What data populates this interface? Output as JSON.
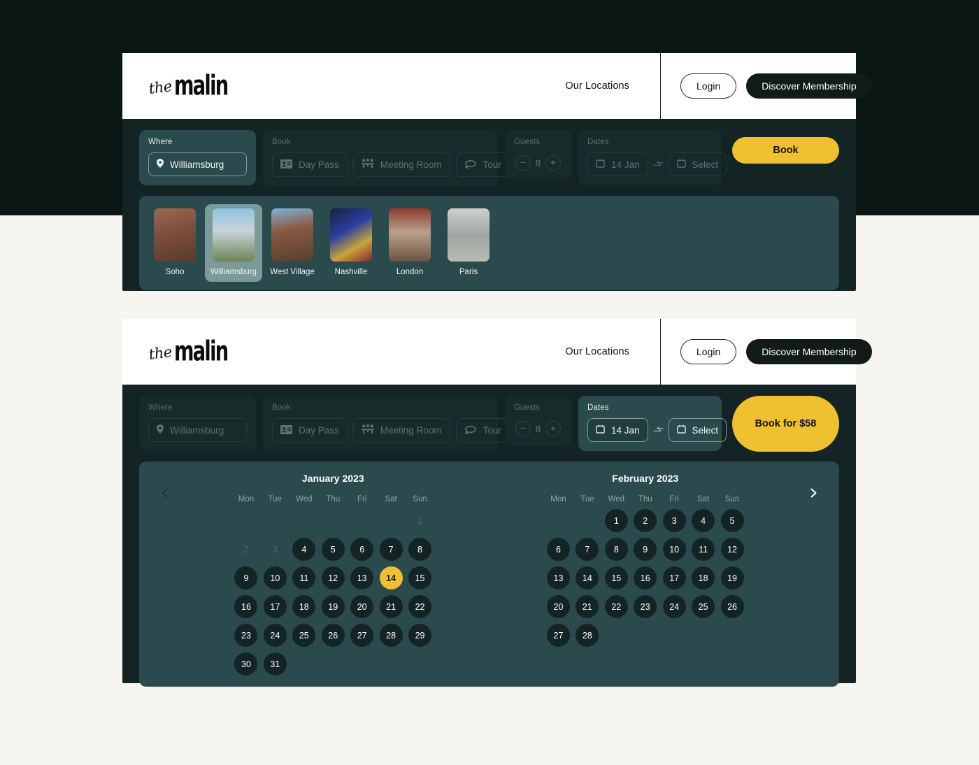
{
  "colors": {
    "page_background": "#F7F5F0",
    "top_band": "#091614",
    "panel": "#142425",
    "teal": "#2B4A4E",
    "accent_yellow": "#EFC02F",
    "selected_card": "#7C9A99"
  },
  "header": {
    "logo_the": "the",
    "logo_malin": "malin",
    "nav_locations": "Our Locations",
    "login_label": "Login",
    "membership_label": "Discover Membership"
  },
  "panel_one": {
    "where": {
      "label": "Where",
      "value": "Williamsburg",
      "icon": "map-pin-icon"
    },
    "book": {
      "label": "Book",
      "options": [
        {
          "label": "Day Pass",
          "icon": "id-card-icon"
        },
        {
          "label": "Meeting Room",
          "icon": "meeting-people-icon"
        },
        {
          "label": "Tour",
          "icon": "tour-loop-icon"
        }
      ]
    },
    "guests": {
      "label": "Guests",
      "count": "8",
      "minus": "−",
      "plus": "+"
    },
    "dates": {
      "label": "Dates",
      "start_value": "14 Jan",
      "end_placeholder": "Select",
      "arrow": "→",
      "icon": "calendar-icon"
    },
    "cta_label": "Book",
    "locations": [
      {
        "name": "Soho",
        "selected": false
      },
      {
        "name": "Williamsburg",
        "selected": true
      },
      {
        "name": "West Village",
        "selected": false
      },
      {
        "name": "Nashville",
        "selected": false
      },
      {
        "name": "London",
        "selected": false
      },
      {
        "name": "Paris",
        "selected": false
      }
    ]
  },
  "panel_two": {
    "where": {
      "label": "Where",
      "value": "Williamsburg",
      "icon": "map-pin-icon"
    },
    "book": {
      "label": "Book",
      "options": [
        {
          "label": "Day Pass",
          "icon": "id-card-icon"
        },
        {
          "label": "Meeting Room",
          "icon": "meeting-people-icon"
        },
        {
          "label": "Tour",
          "icon": "tour-loop-icon"
        }
      ]
    },
    "guests": {
      "label": "Guests",
      "count": "8",
      "minus": "−",
      "plus": "+"
    },
    "dates": {
      "label": "Dates",
      "start_value": "14 Jan",
      "end_placeholder": "Select",
      "arrow": "→",
      "icon": "calendar-icon"
    },
    "cta_label": "Book for $58",
    "calendar": {
      "prev_enabled": false,
      "next_enabled": true,
      "weekdays": [
        "Mon",
        "Tue",
        "Wed",
        "Thu",
        "Fri",
        "Sat",
        "Sun"
      ],
      "months": [
        {
          "title": "January 2023",
          "lead_blanks": 6,
          "days": [
            {
              "n": "1",
              "state": "off"
            },
            {
              "n": "2",
              "state": "off"
            },
            {
              "n": "3",
              "state": "off"
            },
            {
              "n": "4",
              "state": "avail"
            },
            {
              "n": "5",
              "state": "avail"
            },
            {
              "n": "6",
              "state": "avail"
            },
            {
              "n": "7",
              "state": "avail"
            },
            {
              "n": "8",
              "state": "avail"
            },
            {
              "n": "9",
              "state": "avail"
            },
            {
              "n": "10",
              "state": "avail"
            },
            {
              "n": "11",
              "state": "avail"
            },
            {
              "n": "12",
              "state": "avail"
            },
            {
              "n": "13",
              "state": "avail"
            },
            {
              "n": "14",
              "state": "sel"
            },
            {
              "n": "15",
              "state": "avail"
            },
            {
              "n": "16",
              "state": "avail"
            },
            {
              "n": "17",
              "state": "avail"
            },
            {
              "n": "18",
              "state": "avail"
            },
            {
              "n": "19",
              "state": "avail"
            },
            {
              "n": "20",
              "state": "avail"
            },
            {
              "n": "21",
              "state": "avail"
            },
            {
              "n": "22",
              "state": "avail"
            },
            {
              "n": "23",
              "state": "avail"
            },
            {
              "n": "24",
              "state": "avail"
            },
            {
              "n": "25",
              "state": "avail"
            },
            {
              "n": "26",
              "state": "avail"
            },
            {
              "n": "27",
              "state": "avail"
            },
            {
              "n": "28",
              "state": "avail"
            },
            {
              "n": "29",
              "state": "avail"
            },
            {
              "n": "30",
              "state": "avail"
            },
            {
              "n": "31",
              "state": "avail"
            }
          ]
        },
        {
          "title": "February 2023",
          "lead_blanks": 2,
          "days": [
            {
              "n": "1",
              "state": "avail"
            },
            {
              "n": "2",
              "state": "avail"
            },
            {
              "n": "3",
              "state": "avail"
            },
            {
              "n": "4",
              "state": "avail"
            },
            {
              "n": "5",
              "state": "avail"
            },
            {
              "n": "6",
              "state": "avail"
            },
            {
              "n": "7",
              "state": "avail"
            },
            {
              "n": "8",
              "state": "avail"
            },
            {
              "n": "9",
              "state": "avail"
            },
            {
              "n": "10",
              "state": "avail"
            },
            {
              "n": "11",
              "state": "avail"
            },
            {
              "n": "12",
              "state": "avail"
            },
            {
              "n": "13",
              "state": "avail"
            },
            {
              "n": "14",
              "state": "avail"
            },
            {
              "n": "15",
              "state": "avail"
            },
            {
              "n": "16",
              "state": "avail"
            },
            {
              "n": "17",
              "state": "avail"
            },
            {
              "n": "18",
              "state": "avail"
            },
            {
              "n": "19",
              "state": "avail"
            },
            {
              "n": "20",
              "state": "avail"
            },
            {
              "n": "21",
              "state": "avail"
            },
            {
              "n": "22",
              "state": "avail"
            },
            {
              "n": "23",
              "state": "avail"
            },
            {
              "n": "24",
              "state": "avail"
            },
            {
              "n": "25",
              "state": "avail"
            },
            {
              "n": "26",
              "state": "avail"
            },
            {
              "n": "27",
              "state": "avail"
            },
            {
              "n": "28",
              "state": "avail"
            }
          ]
        }
      ]
    }
  }
}
